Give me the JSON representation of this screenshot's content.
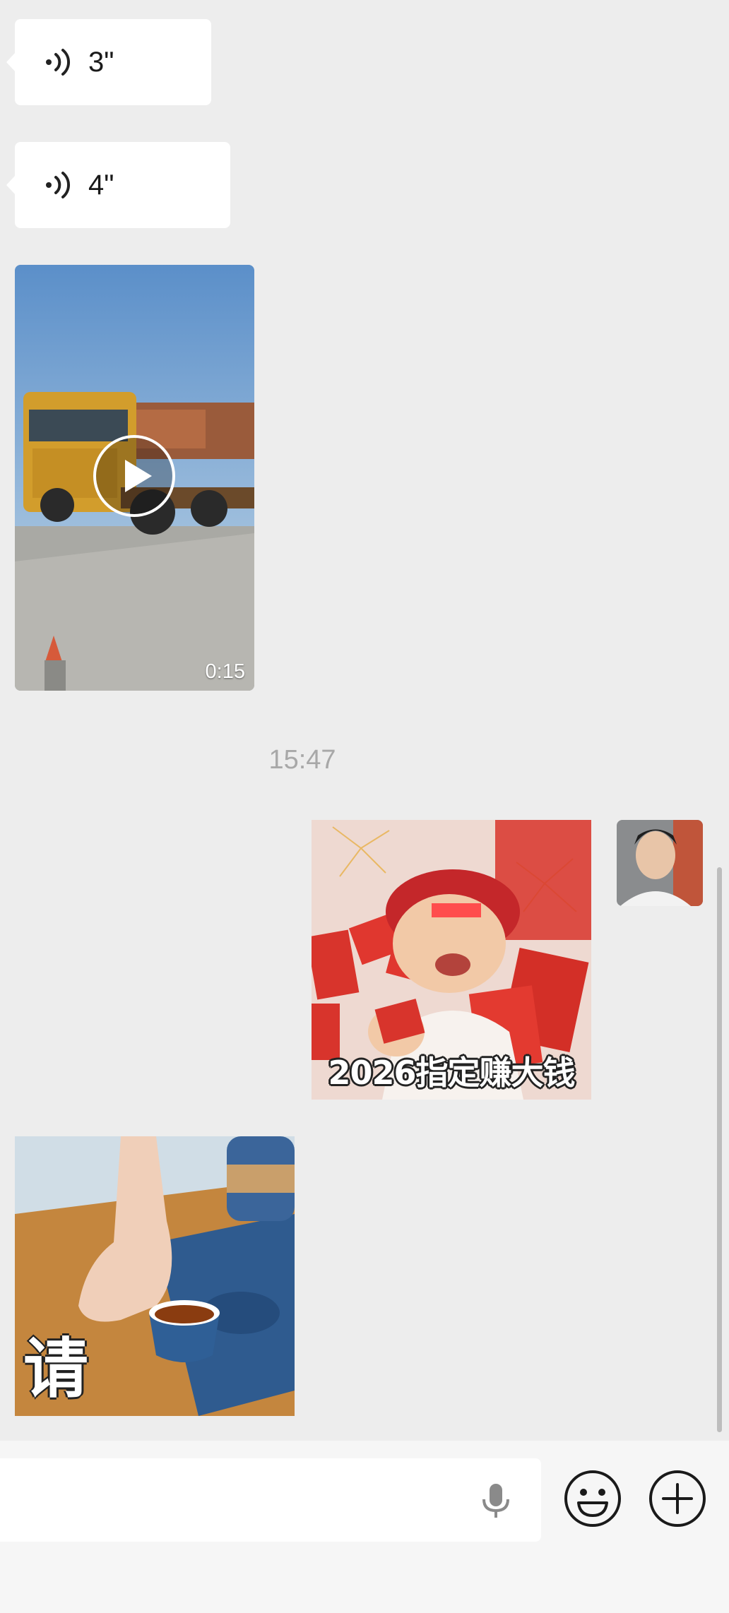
{
  "messages": {
    "voice_1": {
      "duration": "3\""
    },
    "voice_2": {
      "duration": "4\""
    },
    "video": {
      "duration": "0:15"
    },
    "timestamp": "15:47",
    "sticker_1": {
      "caption": "2026指定赚大钱"
    },
    "sticker_2": {
      "caption": "请"
    }
  },
  "input": {
    "placeholder": ""
  },
  "icons": {
    "voice": "voice-wave-icon",
    "play": "play-icon",
    "mic": "microphone-icon",
    "emoji": "smiley-icon",
    "plus": "plus-circle-icon"
  },
  "colors": {
    "background": "#ededed",
    "bubble": "#ffffff",
    "timestamp": "#a8a8a8",
    "input_bar": "#f6f6f6"
  }
}
